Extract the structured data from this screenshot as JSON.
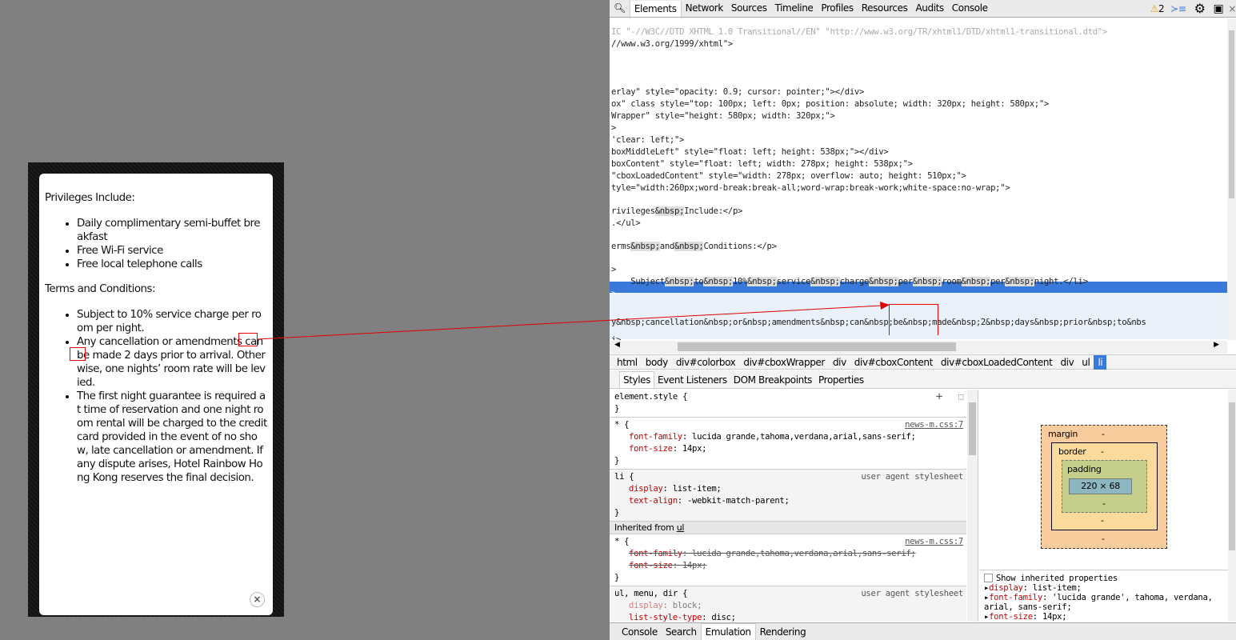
{
  "modal": {
    "privileges_heading": "Privileges Include:",
    "privileges": [
      "Daily complimentary semi-buffet bre akfast",
      "Free Wi-Fi service",
      "Free local telephone calls"
    ],
    "terms_heading": "Terms and Conditions:",
    "terms": [
      "Subject to 10% service charge per room per night.",
      "Any cancellation or amendments can be made 2 days prior to arrival. Otherwise, one nights’ room rate will be levied.",
      "The first night guarantee is required at time of reservation and one night  room rental will be charged to the credit card provided in the event of no show, late cancellation or amendment. If any dispute arises, Hotel Rainbow Hong Kong reserves the final decision."
    ],
    "close_label": "×"
  },
  "devtools": {
    "tabs": [
      "Elements",
      "Network",
      "Sources",
      "Timeline",
      "Profiles",
      "Resources",
      "Audits",
      "Console"
    ],
    "warning_count": "2",
    "source_lines": [
      "IC \"-//W3C//DTD XHTML 1.0 Transitional//EN\" \"http://www.w3.org/TR/xhtml1/DTD/xhtml1-transitional.dtd\">",
      "//www.w3.org/1999/xhtml\">",
      "erlay\" style=\"opacity: 0.9; cursor: pointer;\"></div>",
      "ox\" class style=\"top: 100px; left: 0px; position: absolute; width: 320px; height: 580px;\">",
      "Wrapper\" style=\"height: 580px; width: 320px;\">",
      ">",
      "'clear: left;\">",
      "boxMiddleLeft\" style=\"float: left; height: 538px;\"></div>",
      "boxContent\" style=\"float: left; width: 278px; height: 538px;\">",
      "\"cboxLoadedContent\" style=\"width: 278px; overflow: auto; height: 510px;\">",
      "tyle=\"width:260px;word-break:break-all;word-wrap:break-work;white-space:no-wrap;\">",
      "rivileges&nbsp;Include:</p>",
      ".</ul>",
      "erms&nbsp;and&nbsp;Conditions:</p>",
      ">",
      "    Subject&nbsp;to&nbsp;10%&nbsp;service&nbsp;charge&nbsp;per&nbsp;room&nbsp;per&nbsp;night.</li>",
      ">",
      "y&nbsp;cancellation&nbsp;or&nbsp;amendments&nbsp;can&nbsp;be&nbsp;made&nbsp;2&nbsp;days&nbsp;prior&nbsp;to&nbs",
      "i>"
    ],
    "breadcrumbs": [
      "html",
      "body",
      "div#colorbox",
      "div#cboxWrapper",
      "div",
      "div#cboxContent",
      "div#cboxLoadedContent",
      "div",
      "ul",
      "li"
    ],
    "sidebar_tabs": [
      "Styles",
      "Event Listeners",
      "DOM Breakpoints",
      "Properties"
    ],
    "styles": {
      "element_style": "element.style {",
      "rule1": {
        "selector": "* {",
        "source": "news-m.css:7",
        "props": [
          [
            "font-family",
            "lucida grande,tahoma,verdana,arial,sans-serif;"
          ],
          [
            "font-size",
            "14px;"
          ]
        ]
      },
      "rule2": {
        "selector": "li {",
        "source": "user agent stylesheet",
        "props": [
          [
            "display",
            "list-item;"
          ],
          [
            "text-align",
            "-webkit-match-parent;"
          ]
        ]
      },
      "inherited_label": "Inherited from",
      "inherited_from": "ul",
      "rule3": {
        "selector": "* {",
        "source": "news-m.css:7",
        "props": [
          [
            "font-family",
            "lucida grande,tahoma,verdana,arial,sans-serif;"
          ],
          [
            "font-size",
            "14px;"
          ]
        ]
      },
      "rule4": {
        "selector": "ul, menu, dir {",
        "source": "user agent stylesheet",
        "props": [
          [
            "display",
            "block;"
          ],
          [
            "list-style-type",
            "disc;"
          ]
        ]
      },
      "close_brace": "}"
    },
    "box_model": {
      "margin": "margin",
      "border": "border",
      "padding": "padding",
      "content": "220 × 68",
      "dash": "-"
    },
    "computed": {
      "show_inherited": "Show inherited properties",
      "props": [
        [
          "display",
          "list-item;"
        ],
        [
          "font-family",
          "'lucida grande', tahoma, verdana, arial, sans-serif;"
        ],
        [
          "font-size",
          "14px;"
        ]
      ]
    },
    "drawer_tabs": [
      "Console",
      "Search",
      "Emulation",
      "Rendering"
    ],
    "colors": {
      "selection": "#3879d9",
      "annotation": "#e00000"
    }
  }
}
